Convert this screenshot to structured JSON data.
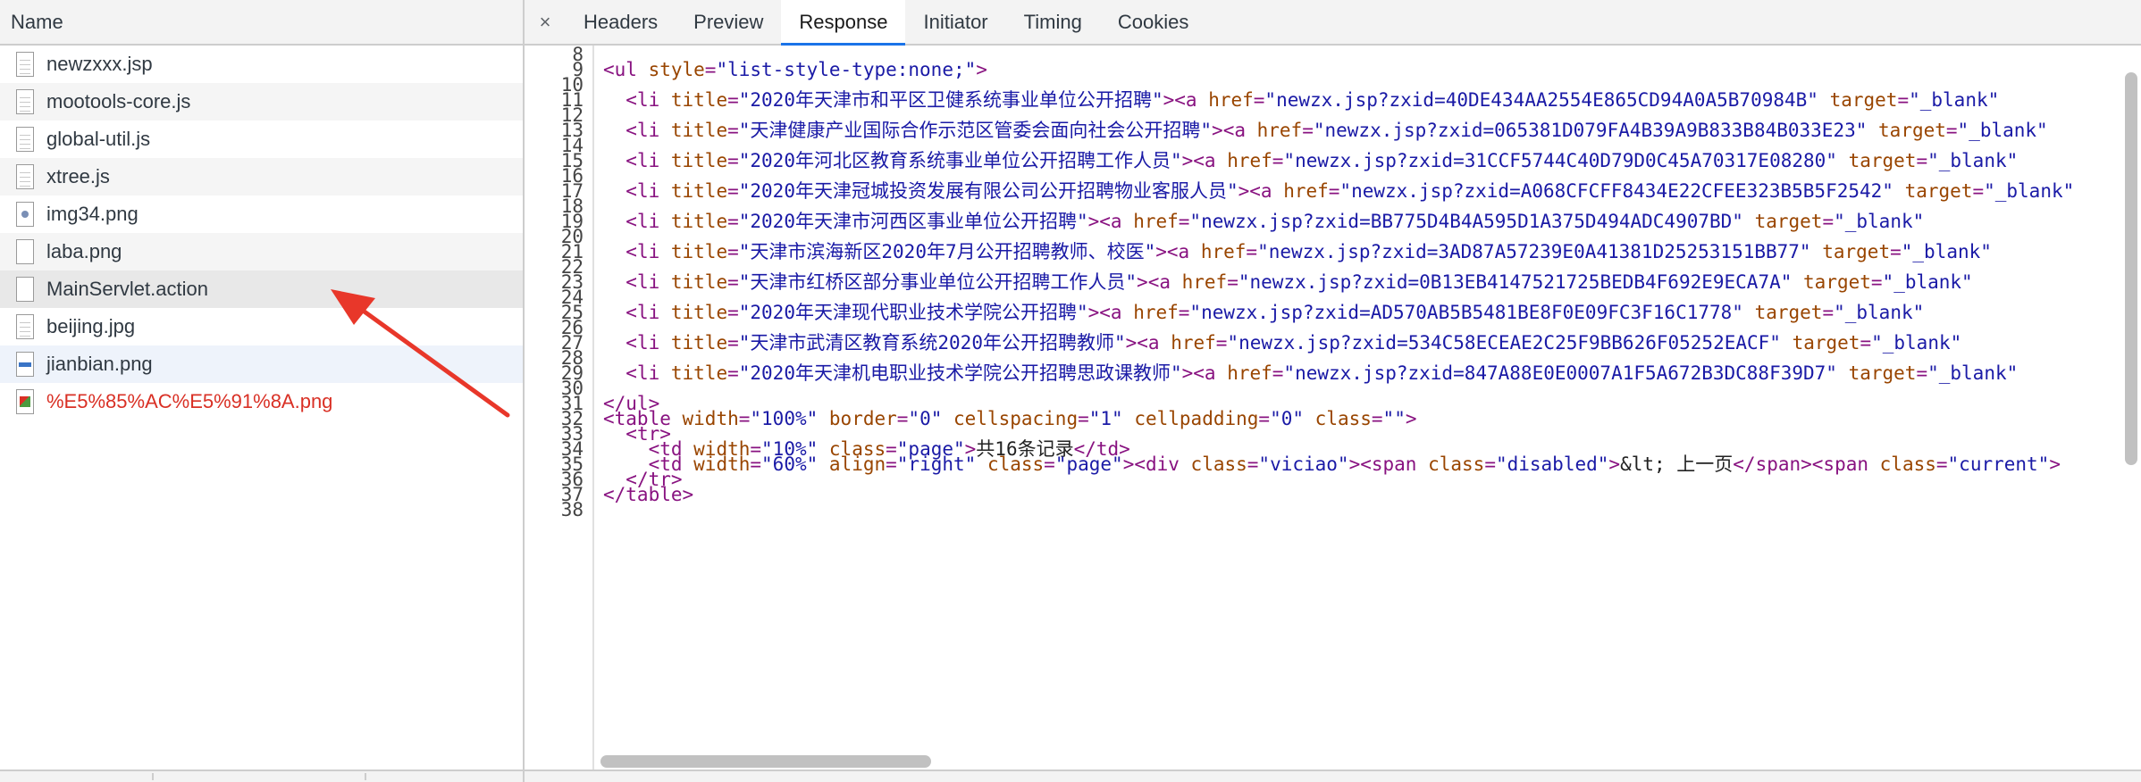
{
  "left_panel": {
    "header": "Name",
    "files": [
      {
        "name": "newzxxx.jsp",
        "icon": "document-icon"
      },
      {
        "name": "mootools-core.js",
        "icon": "document-icon"
      },
      {
        "name": "global-util.js",
        "icon": "document-icon"
      },
      {
        "name": "xtree.js",
        "icon": "document-icon"
      },
      {
        "name": "img34.png",
        "icon": "image-icon"
      },
      {
        "name": "laba.png",
        "icon": "blank-file-icon"
      },
      {
        "name": "MainServlet.action",
        "icon": "blank-file-icon"
      },
      {
        "name": "beijing.jpg",
        "icon": "document-icon"
      },
      {
        "name": "jianbian.png",
        "icon": "image-band-icon"
      },
      {
        "name": "%E5%85%AC%E5%91%8A.png",
        "icon": "broken-image-icon",
        "status": "error"
      }
    ]
  },
  "tabs": {
    "close": "×",
    "items": [
      "Headers",
      "Preview",
      "Response",
      "Initiator",
      "Timing",
      "Cookies"
    ],
    "active": "Response"
  },
  "code": {
    "line_numbers": [
      "8",
      "9",
      "10",
      "11",
      "12",
      "13",
      "14",
      "15",
      "16",
      "17",
      "18",
      "19",
      "20",
      "21",
      "22",
      "23",
      "24",
      "25",
      "26",
      "27",
      "28",
      "29",
      "30",
      "31",
      "32",
      "33",
      "34",
      "35",
      "36",
      "37",
      "38"
    ],
    "lines": [
      {
        "n": "9",
        "parts": [
          [
            "t",
            "<ul "
          ],
          [
            "a",
            "style"
          ],
          [
            "t",
            "="
          ],
          [
            "v",
            "\"list-style-type:none;\""
          ],
          [
            "t",
            ">"
          ]
        ]
      },
      {
        "n": "11",
        "parts": [
          [
            "x",
            "  "
          ],
          [
            "t",
            "<li "
          ],
          [
            "a",
            "title"
          ],
          [
            "t",
            "="
          ],
          [
            "v",
            "\"2020年天津市和平区卫健系统事业单位公开招聘\""
          ],
          [
            "t",
            "><a "
          ],
          [
            "a",
            "href"
          ],
          [
            "t",
            "="
          ],
          [
            "v",
            "\"newzx.jsp?zxid=40DE434AA2554E865CD94A0A5B70984B\""
          ],
          [
            "x",
            " "
          ],
          [
            "a",
            "target"
          ],
          [
            "t",
            "="
          ],
          [
            "v",
            "\"_blank\""
          ]
        ]
      },
      {
        "n": "13",
        "parts": [
          [
            "x",
            "  "
          ],
          [
            "t",
            "<li "
          ],
          [
            "a",
            "title"
          ],
          [
            "t",
            "="
          ],
          [
            "v",
            "\"天津健康产业国际合作示范区管委会面向社会公开招聘\""
          ],
          [
            "t",
            "><a "
          ],
          [
            "a",
            "href"
          ],
          [
            "t",
            "="
          ],
          [
            "v",
            "\"newzx.jsp?zxid=065381D079FA4B39A9B833B84B033E23\""
          ],
          [
            "x",
            " "
          ],
          [
            "a",
            "target"
          ],
          [
            "t",
            "="
          ],
          [
            "v",
            "\"_blank\""
          ]
        ]
      },
      {
        "n": "15",
        "parts": [
          [
            "x",
            "  "
          ],
          [
            "t",
            "<li "
          ],
          [
            "a",
            "title"
          ],
          [
            "t",
            "="
          ],
          [
            "v",
            "\"2020年河北区教育系统事业单位公开招聘工作人员\""
          ],
          [
            "t",
            "><a "
          ],
          [
            "a",
            "href"
          ],
          [
            "t",
            "="
          ],
          [
            "v",
            "\"newzx.jsp?zxid=31CCF5744C40D79D0C45A70317E08280\""
          ],
          [
            "x",
            " "
          ],
          [
            "a",
            "target"
          ],
          [
            "t",
            "="
          ],
          [
            "v",
            "\"_blank\""
          ]
        ]
      },
      {
        "n": "17",
        "parts": [
          [
            "x",
            "  "
          ],
          [
            "t",
            "<li "
          ],
          [
            "a",
            "title"
          ],
          [
            "t",
            "="
          ],
          [
            "v",
            "\"2020年天津冠城投资发展有限公司公开招聘物业客服人员\""
          ],
          [
            "t",
            "><a "
          ],
          [
            "a",
            "href"
          ],
          [
            "t",
            "="
          ],
          [
            "v",
            "\"newzx.jsp?zxid=A068CFCFF8434E22CFEE323B5B5F2542\""
          ],
          [
            "x",
            " "
          ],
          [
            "a",
            "target"
          ],
          [
            "t",
            "="
          ],
          [
            "v",
            "\"_blank\""
          ]
        ]
      },
      {
        "n": "19",
        "parts": [
          [
            "x",
            "  "
          ],
          [
            "t",
            "<li "
          ],
          [
            "a",
            "title"
          ],
          [
            "t",
            "="
          ],
          [
            "v",
            "\"2020年天津市河西区事业单位公开招聘\""
          ],
          [
            "t",
            "><a "
          ],
          [
            "a",
            "href"
          ],
          [
            "t",
            "="
          ],
          [
            "v",
            "\"newzx.jsp?zxid=BB775D4B4A595D1A375D494ADC4907BD\""
          ],
          [
            "x",
            " "
          ],
          [
            "a",
            "target"
          ],
          [
            "t",
            "="
          ],
          [
            "v",
            "\"_blank\""
          ]
        ]
      },
      {
        "n": "21",
        "parts": [
          [
            "x",
            "  "
          ],
          [
            "t",
            "<li "
          ],
          [
            "a",
            "title"
          ],
          [
            "t",
            "="
          ],
          [
            "v",
            "\"天津市滨海新区2020年7月公开招聘教师、校医\""
          ],
          [
            "t",
            "><a "
          ],
          [
            "a",
            "href"
          ],
          [
            "t",
            "="
          ],
          [
            "v",
            "\"newzx.jsp?zxid=3AD87A57239E0A41381D25253151BB77\""
          ],
          [
            "x",
            " "
          ],
          [
            "a",
            "target"
          ],
          [
            "t",
            "="
          ],
          [
            "v",
            "\"_blank\""
          ]
        ]
      },
      {
        "n": "23",
        "parts": [
          [
            "x",
            "  "
          ],
          [
            "t",
            "<li "
          ],
          [
            "a",
            "title"
          ],
          [
            "t",
            "="
          ],
          [
            "v",
            "\"天津市红桥区部分事业单位公开招聘工作人员\""
          ],
          [
            "t",
            "><a "
          ],
          [
            "a",
            "href"
          ],
          [
            "t",
            "="
          ],
          [
            "v",
            "\"newzx.jsp?zxid=0B13EB4147521725BEDB4F692E9ECA7A\""
          ],
          [
            "x",
            " "
          ],
          [
            "a",
            "target"
          ],
          [
            "t",
            "="
          ],
          [
            "v",
            "\"_blank\""
          ]
        ]
      },
      {
        "n": "25",
        "parts": [
          [
            "x",
            "  "
          ],
          [
            "t",
            "<li "
          ],
          [
            "a",
            "title"
          ],
          [
            "t",
            "="
          ],
          [
            "v",
            "\"2020年天津现代职业技术学院公开招聘\""
          ],
          [
            "t",
            "><a "
          ],
          [
            "a",
            "href"
          ],
          [
            "t",
            "="
          ],
          [
            "v",
            "\"newzx.jsp?zxid=AD570AB5B5481BE8F0E09FC3F16C1778\""
          ],
          [
            "x",
            " "
          ],
          [
            "a",
            "target"
          ],
          [
            "t",
            "="
          ],
          [
            "v",
            "\"_blank\""
          ]
        ]
      },
      {
        "n": "27",
        "parts": [
          [
            "x",
            "  "
          ],
          [
            "t",
            "<li "
          ],
          [
            "a",
            "title"
          ],
          [
            "t",
            "="
          ],
          [
            "v",
            "\"天津市武清区教育系统2020年公开招聘教师\""
          ],
          [
            "t",
            "><a "
          ],
          [
            "a",
            "href"
          ],
          [
            "t",
            "="
          ],
          [
            "v",
            "\"newzx.jsp?zxid=534C58ECEAE2C25F9BB626F05252EACF\""
          ],
          [
            "x",
            " "
          ],
          [
            "a",
            "target"
          ],
          [
            "t",
            "="
          ],
          [
            "v",
            "\"_blank\""
          ]
        ]
      },
      {
        "n": "29",
        "parts": [
          [
            "x",
            "  "
          ],
          [
            "t",
            "<li "
          ],
          [
            "a",
            "title"
          ],
          [
            "t",
            "="
          ],
          [
            "v",
            "\"2020年天津机电职业技术学院公开招聘思政课教师\""
          ],
          [
            "t",
            "><a "
          ],
          [
            "a",
            "href"
          ],
          [
            "t",
            "="
          ],
          [
            "v",
            "\"newzx.jsp?zxid=847A88E0E0007A1F5A672B3DC88F39D7\""
          ],
          [
            "x",
            " "
          ],
          [
            "a",
            "target"
          ],
          [
            "t",
            "="
          ],
          [
            "v",
            "\"_blank\""
          ]
        ]
      },
      {
        "n": "31",
        "parts": [
          [
            "t",
            "</ul>"
          ]
        ]
      },
      {
        "n": "32",
        "parts": [
          [
            "t",
            "<table "
          ],
          [
            "a",
            "width"
          ],
          [
            "t",
            "="
          ],
          [
            "v",
            "\"100%\""
          ],
          [
            "x",
            " "
          ],
          [
            "a",
            "border"
          ],
          [
            "t",
            "="
          ],
          [
            "v",
            "\"0\""
          ],
          [
            "x",
            " "
          ],
          [
            "a",
            "cellspacing"
          ],
          [
            "t",
            "="
          ],
          [
            "v",
            "\"1\""
          ],
          [
            "x",
            " "
          ],
          [
            "a",
            "cellpadding"
          ],
          [
            "t",
            "="
          ],
          [
            "v",
            "\"0\""
          ],
          [
            "x",
            " "
          ],
          [
            "a",
            "class"
          ],
          [
            "t",
            "="
          ],
          [
            "v",
            "\"\""
          ],
          [
            "t",
            ">"
          ]
        ]
      },
      {
        "n": "33",
        "parts": [
          [
            "x",
            "  "
          ],
          [
            "t",
            "<tr>"
          ]
        ]
      },
      {
        "n": "34",
        "parts": [
          [
            "x",
            "    "
          ],
          [
            "t",
            "<td "
          ],
          [
            "a",
            "width"
          ],
          [
            "t",
            "="
          ],
          [
            "v",
            "\"10%\""
          ],
          [
            "x",
            " "
          ],
          [
            "a",
            "class"
          ],
          [
            "t",
            "="
          ],
          [
            "v",
            "\"page\""
          ],
          [
            "t",
            ">"
          ],
          [
            "x",
            "共16条记录"
          ],
          [
            "t",
            "</td>"
          ]
        ]
      },
      {
        "n": "35",
        "parts": [
          [
            "x",
            "    "
          ],
          [
            "t",
            "<td "
          ],
          [
            "a",
            "width"
          ],
          [
            "t",
            "="
          ],
          [
            "v",
            "\"60%\""
          ],
          [
            "x",
            " "
          ],
          [
            "a",
            "align"
          ],
          [
            "t",
            "="
          ],
          [
            "v",
            "\"right\""
          ],
          [
            "x",
            " "
          ],
          [
            "a",
            "class"
          ],
          [
            "t",
            "="
          ],
          [
            "v",
            "\"page\""
          ],
          [
            "t",
            "><div "
          ],
          [
            "a",
            "class"
          ],
          [
            "t",
            "="
          ],
          [
            "v",
            "\"viciao\""
          ],
          [
            "t",
            "><span "
          ],
          [
            "a",
            "class"
          ],
          [
            "t",
            "="
          ],
          [
            "v",
            "\"disabled\""
          ],
          [
            "t",
            ">"
          ],
          [
            "x",
            "&lt; 上一页"
          ],
          [
            "t",
            "</span><span "
          ],
          [
            "a",
            "class"
          ],
          [
            "t",
            "="
          ],
          [
            "v",
            "\"current\""
          ],
          [
            "t",
            ">"
          ]
        ]
      },
      {
        "n": "36",
        "parts": [
          [
            "x",
            "  "
          ],
          [
            "t",
            "</tr>"
          ]
        ]
      },
      {
        "n": "37",
        "parts": [
          [
            "t",
            "</table>"
          ]
        ]
      }
    ]
  },
  "colors": {
    "tag": "#881280",
    "attribute": "#994500",
    "value": "#1a1aa6",
    "active_tab_underline": "#1a73e8",
    "error_text": "#d93025",
    "arrow": "#e8372a"
  }
}
